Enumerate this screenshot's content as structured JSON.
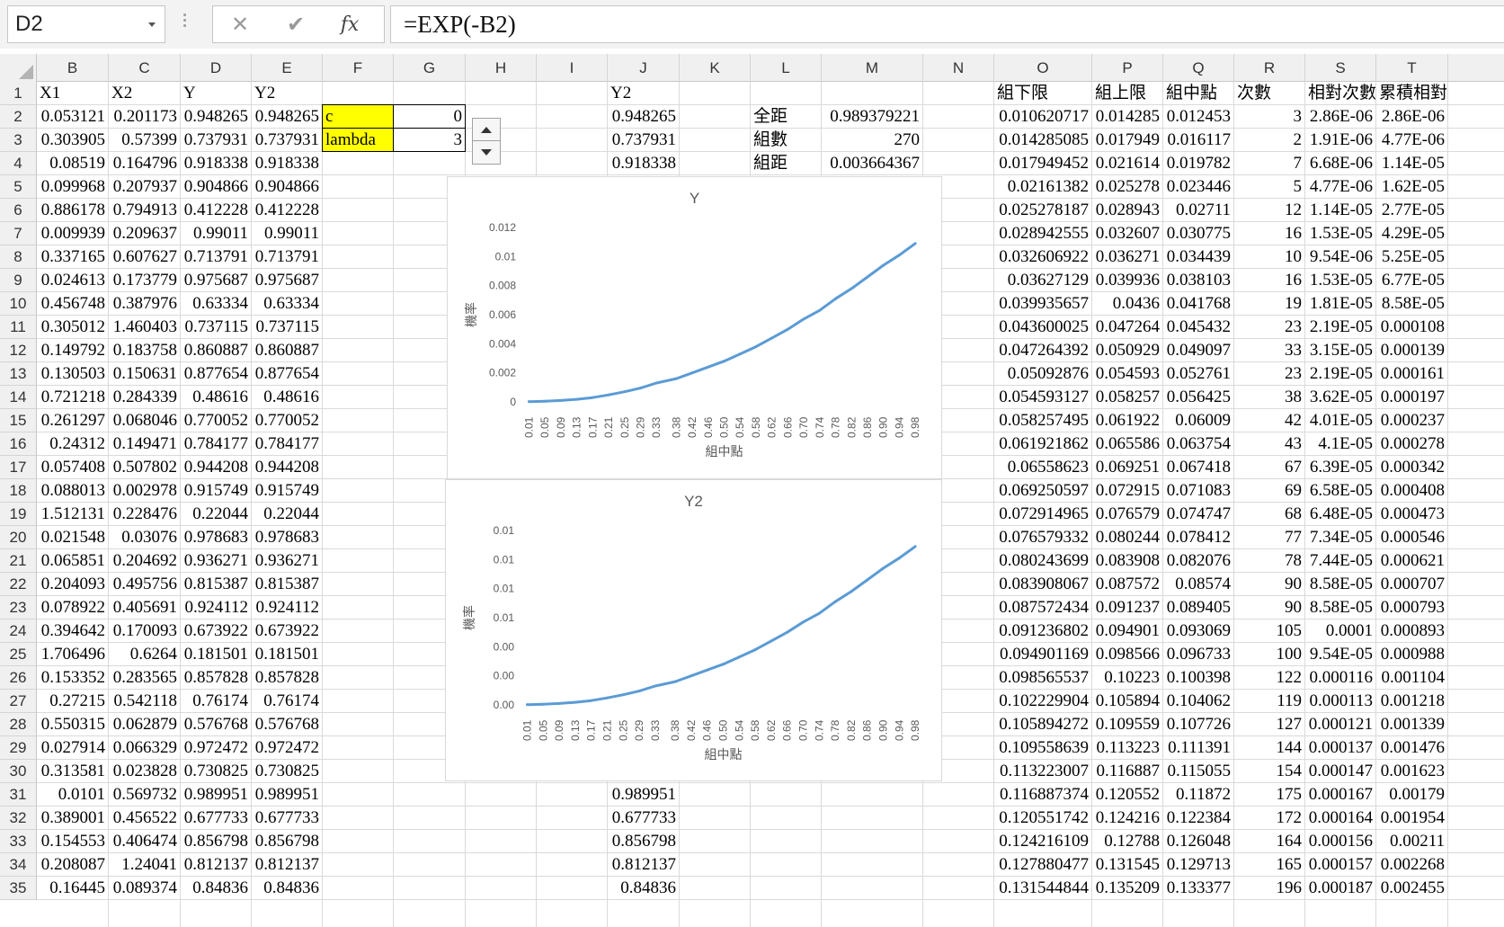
{
  "formula_bar": {
    "name_box": "D2",
    "cancel_icon": "✕",
    "enter_icon": "✔",
    "fx_label": "fx",
    "formula": "=EXP(-B2)"
  },
  "columns": [
    "B",
    "C",
    "D",
    "E",
    "F",
    "G",
    "H",
    "I",
    "J",
    "K",
    "L",
    "M",
    "N",
    "O",
    "P",
    "Q",
    "R",
    "S",
    "T"
  ],
  "rows": [
    "1",
    "2",
    "3",
    "4",
    "5",
    "6",
    "7",
    "8",
    "9",
    "10",
    "11",
    "12",
    "13",
    "14",
    "15",
    "16",
    "17",
    "18",
    "19",
    "20",
    "21",
    "22",
    "23",
    "24",
    "25",
    "26",
    "27",
    "28",
    "29",
    "30",
    "31",
    "32",
    "33",
    "34",
    "35"
  ],
  "headers": {
    "B": "X1",
    "C": "X2",
    "D": "Y",
    "E": "Y2",
    "J": "Y2",
    "O": "組下限",
    "P": "組上限",
    "Q": "組中點",
    "R": "次數",
    "S": "相對次數",
    "T": "累積相對次"
  },
  "params": {
    "c_label": "c",
    "c_value": "0",
    "lambda_label": "lambda",
    "lambda_value": "3"
  },
  "stats": {
    "range_label": "全距",
    "range_value": "0.989379221",
    "groups_label": "組數",
    "groups_value": "270",
    "width_label": "組距",
    "width_value": "0.003664367"
  },
  "data_BCDE": [
    [
      "0.053121",
      "0.201173",
      "0.948265",
      "0.948265"
    ],
    [
      "0.303905",
      "0.57399",
      "0.737931",
      "0.737931"
    ],
    [
      "0.08519",
      "0.164796",
      "0.918338",
      "0.918338"
    ],
    [
      "0.099968",
      "0.207937",
      "0.904866",
      "0.904866"
    ],
    [
      "0.886178",
      "0.794913",
      "0.412228",
      "0.412228"
    ],
    [
      "0.009939",
      "0.209637",
      "0.99011",
      "0.99011"
    ],
    [
      "0.337165",
      "0.607627",
      "0.713791",
      "0.713791"
    ],
    [
      "0.024613",
      "0.173779",
      "0.975687",
      "0.975687"
    ],
    [
      "0.456748",
      "0.387976",
      "0.63334",
      "0.63334"
    ],
    [
      "0.305012",
      "1.460403",
      "0.737115",
      "0.737115"
    ],
    [
      "0.149792",
      "0.183758",
      "0.860887",
      "0.860887"
    ],
    [
      "0.130503",
      "0.150631",
      "0.877654",
      "0.877654"
    ],
    [
      "0.721218",
      "0.284339",
      "0.48616",
      "0.48616"
    ],
    [
      "0.261297",
      "0.068046",
      "0.770052",
      "0.770052"
    ],
    [
      "0.24312",
      "0.149471",
      "0.784177",
      "0.784177"
    ],
    [
      "0.057408",
      "0.507802",
      "0.944208",
      "0.944208"
    ],
    [
      "0.088013",
      "0.002978",
      "0.915749",
      "0.915749"
    ],
    [
      "1.512131",
      "0.228476",
      "0.22044",
      "0.22044"
    ],
    [
      "0.021548",
      "0.03076",
      "0.978683",
      "0.978683"
    ],
    [
      "0.065851",
      "0.204692",
      "0.936271",
      "0.936271"
    ],
    [
      "0.204093",
      "0.495756",
      "0.815387",
      "0.815387"
    ],
    [
      "0.078922",
      "0.405691",
      "0.924112",
      "0.924112"
    ],
    [
      "0.394642",
      "0.170093",
      "0.673922",
      "0.673922"
    ],
    [
      "1.706496",
      "0.6264",
      "0.181501",
      "0.181501"
    ],
    [
      "0.153352",
      "0.283565",
      "0.857828",
      "0.857828"
    ],
    [
      "0.27215",
      "0.542118",
      "0.76174",
      "0.76174"
    ],
    [
      "0.550315",
      "0.062879",
      "0.576768",
      "0.576768"
    ],
    [
      "0.027914",
      "0.066329",
      "0.972472",
      "0.972472"
    ],
    [
      "0.313581",
      "0.023828",
      "0.730825",
      "0.730825"
    ],
    [
      "0.0101",
      "0.569732",
      "0.989951",
      "0.989951"
    ],
    [
      "0.389001",
      "0.456522",
      "0.677733",
      "0.677733"
    ],
    [
      "0.154553",
      "0.406474",
      "0.856798",
      "0.856798"
    ],
    [
      "0.208087",
      "1.24041",
      "0.812137",
      "0.812137"
    ],
    [
      "0.16445",
      "0.089374",
      "0.84836",
      "0.84836"
    ]
  ],
  "data_J_top": [
    "0.948265",
    "0.737931",
    "0.918338"
  ],
  "data_J_bottom": [
    "0.989951",
    "0.677733",
    "0.856798",
    "0.812137",
    "0.84836"
  ],
  "data_OPQRST": [
    [
      "0.010620717",
      "0.014285",
      "0.012453",
      "3",
      "2.86E-06",
      "2.86E-06"
    ],
    [
      "0.014285085",
      "0.017949",
      "0.016117",
      "2",
      "1.91E-06",
      "4.77E-06"
    ],
    [
      "0.017949452",
      "0.021614",
      "0.019782",
      "7",
      "6.68E-06",
      "1.14E-05"
    ],
    [
      "0.02161382",
      "0.025278",
      "0.023446",
      "5",
      "4.77E-06",
      "1.62E-05"
    ],
    [
      "0.025278187",
      "0.028943",
      "0.02711",
      "12",
      "1.14E-05",
      "2.77E-05"
    ],
    [
      "0.028942555",
      "0.032607",
      "0.030775",
      "16",
      "1.53E-05",
      "4.29E-05"
    ],
    [
      "0.032606922",
      "0.036271",
      "0.034439",
      "10",
      "9.54E-06",
      "5.25E-05"
    ],
    [
      "0.03627129",
      "0.039936",
      "0.038103",
      "16",
      "1.53E-05",
      "6.77E-05"
    ],
    [
      "0.039935657",
      "0.0436",
      "0.041768",
      "19",
      "1.81E-05",
      "8.58E-05"
    ],
    [
      "0.043600025",
      "0.047264",
      "0.045432",
      "23",
      "2.19E-05",
      "0.000108"
    ],
    [
      "0.047264392",
      "0.050929",
      "0.049097",
      "33",
      "3.15E-05",
      "0.000139"
    ],
    [
      "0.05092876",
      "0.054593",
      "0.052761",
      "23",
      "2.19E-05",
      "0.000161"
    ],
    [
      "0.054593127",
      "0.058257",
      "0.056425",
      "38",
      "3.62E-05",
      "0.000197"
    ],
    [
      "0.058257495",
      "0.061922",
      "0.06009",
      "42",
      "4.01E-05",
      "0.000237"
    ],
    [
      "0.061921862",
      "0.065586",
      "0.063754",
      "43",
      "4.1E-05",
      "0.000278"
    ],
    [
      "0.06558623",
      "0.069251",
      "0.067418",
      "67",
      "6.39E-05",
      "0.000342"
    ],
    [
      "0.069250597",
      "0.072915",
      "0.071083",
      "69",
      "6.58E-05",
      "0.000408"
    ],
    [
      "0.072914965",
      "0.076579",
      "0.074747",
      "68",
      "6.48E-05",
      "0.000473"
    ],
    [
      "0.076579332",
      "0.080244",
      "0.078412",
      "77",
      "7.34E-05",
      "0.000546"
    ],
    [
      "0.080243699",
      "0.083908",
      "0.082076",
      "78",
      "7.44E-05",
      "0.000621"
    ],
    [
      "0.083908067",
      "0.087572",
      "0.08574",
      "90",
      "8.58E-05",
      "0.000707"
    ],
    [
      "0.087572434",
      "0.091237",
      "0.089405",
      "90",
      "8.58E-05",
      "0.000793"
    ],
    [
      "0.091236802",
      "0.094901",
      "0.093069",
      "105",
      "0.0001",
      "0.000893"
    ],
    [
      "0.094901169",
      "0.098566",
      "0.096733",
      "100",
      "9.54E-05",
      "0.000988"
    ],
    [
      "0.098565537",
      "0.10223",
      "0.100398",
      "122",
      "0.000116",
      "0.001104"
    ],
    [
      "0.102229904",
      "0.105894",
      "0.104062",
      "119",
      "0.000113",
      "0.001218"
    ],
    [
      "0.105894272",
      "0.109559",
      "0.107726",
      "127",
      "0.000121",
      "0.001339"
    ],
    [
      "0.109558639",
      "0.113223",
      "0.111391",
      "144",
      "0.000137",
      "0.001476"
    ],
    [
      "0.113223007",
      "0.116887",
      "0.115055",
      "154",
      "0.000147",
      "0.001623"
    ],
    [
      "0.116887374",
      "0.120552",
      "0.11872",
      "175",
      "0.000167",
      "0.00179"
    ],
    [
      "0.120551742",
      "0.124216",
      "0.122384",
      "172",
      "0.000164",
      "0.001954"
    ],
    [
      "0.124216109",
      "0.12788",
      "0.126048",
      "164",
      "0.000156",
      "0.00211"
    ],
    [
      "0.127880477",
      "0.131545",
      "0.129713",
      "165",
      "0.000157",
      "0.002268"
    ],
    [
      "0.131544844",
      "0.135209",
      "0.133377",
      "196",
      "0.000187",
      "0.002455"
    ]
  ],
  "chart_data": [
    {
      "type": "line",
      "title": "Y",
      "xlabel": "組中點",
      "ylabel": "機率",
      "x_ticks": [
        "0.01",
        "0.05",
        "0.09",
        "0.13",
        "0.17",
        "0.21",
        "0.25",
        "0.29",
        "0.33",
        "0.38",
        "0.42",
        "0.46",
        "0.50",
        "0.54",
        "0.58",
        "0.62",
        "0.66",
        "0.70",
        "0.74",
        "0.78",
        "0.82",
        "0.86",
        "0.90",
        "0.94",
        "0.98"
      ],
      "y_ticks": [
        "0",
        "0.002",
        "0.004",
        "0.006",
        "0.008",
        "0.01",
        "0.012"
      ],
      "ylim": [
        0,
        0.012
      ],
      "series": [
        {
          "color": "#5b9bd5",
          "x": [
            0.01,
            0.05,
            0.09,
            0.13,
            0.17,
            0.21,
            0.25,
            0.29,
            0.33,
            0.38,
            0.42,
            0.46,
            0.5,
            0.54,
            0.58,
            0.62,
            0.66,
            0.7,
            0.74,
            0.78,
            0.82,
            0.86,
            0.9,
            0.94,
            0.98
          ],
          "values": [
            2e-05,
            5e-05,
            0.0001,
            0.00018,
            0.0003,
            0.00048,
            0.0007,
            0.00095,
            0.0013,
            0.0016,
            0.002,
            0.0024,
            0.0028,
            0.0033,
            0.0038,
            0.0044,
            0.005,
            0.0057,
            0.0063,
            0.0071,
            0.0078,
            0.0086,
            0.0094,
            0.0101,
            0.0109
          ]
        }
      ]
    },
    {
      "type": "line",
      "title": "Y2",
      "xlabel": "組中點",
      "ylabel": "機率",
      "x_ticks": [
        "0.01",
        "0.05",
        "0.09",
        "0.13",
        "0.17",
        "0.21",
        "0.25",
        "0.29",
        "0.33",
        "0.38",
        "0.42",
        "0.46",
        "0.50",
        "0.54",
        "0.58",
        "0.62",
        "0.66",
        "0.70",
        "0.74",
        "0.78",
        "0.82",
        "0.86",
        "0.90",
        "0.94",
        "0.98"
      ],
      "y_ticks": [
        "0.00",
        "0.00",
        "0.00",
        "0.01",
        "0.01",
        "0.01",
        "0.01"
      ],
      "ylim": [
        0,
        0.012
      ],
      "series": [
        {
          "color": "#5b9bd5",
          "x": [
            0.01,
            0.05,
            0.09,
            0.13,
            0.17,
            0.21,
            0.25,
            0.29,
            0.33,
            0.38,
            0.42,
            0.46,
            0.5,
            0.54,
            0.58,
            0.62,
            0.66,
            0.7,
            0.74,
            0.78,
            0.82,
            0.86,
            0.9,
            0.94,
            0.98
          ],
          "values": [
            2e-05,
            5e-05,
            0.0001,
            0.00018,
            0.0003,
            0.00048,
            0.0007,
            0.00095,
            0.0013,
            0.0016,
            0.002,
            0.0024,
            0.0028,
            0.0033,
            0.0038,
            0.0044,
            0.005,
            0.0057,
            0.0063,
            0.0071,
            0.0078,
            0.0086,
            0.0094,
            0.0101,
            0.0109
          ]
        }
      ]
    }
  ]
}
